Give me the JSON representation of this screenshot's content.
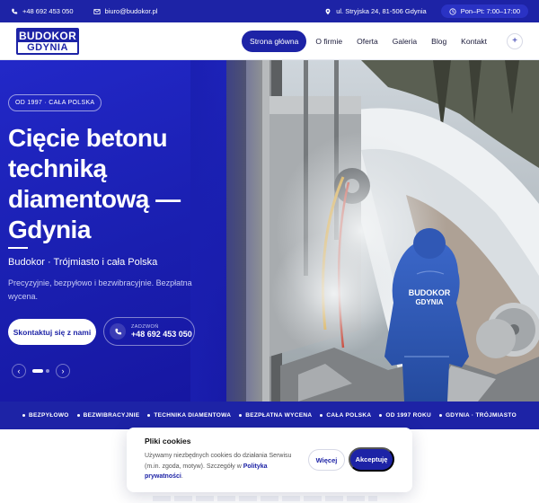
{
  "topbar": {
    "phone": "+48 692 453 050",
    "email": "biuro@budokor.pl",
    "address": "ul. Stryjska 24, 81-506 Gdynia",
    "hours": "Pon–Pt: 7:00–17:00"
  },
  "logo": {
    "top": "BUDOKOR",
    "bottom": "GDYNIA"
  },
  "nav": {
    "items": [
      "Strona główna",
      "O firmie",
      "Oferta",
      "Galeria",
      "Blog",
      "Kontakt"
    ],
    "plus": "+"
  },
  "hero": {
    "badge": "OD 1997 · CAŁA POLSKA",
    "title": "Cięcie betonu techniką diamentową — Gdynia",
    "subtitle": "Budokor · Trójmiasto i cała Polska",
    "description": "Precyzyjnie, bezpyłowo i bezwibracyjnie. Bezpłatna wycena.",
    "cta": "Skontaktuj się z nami",
    "call_label": "ZADZWOŃ",
    "call_number": "+48 692 453 050",
    "prev": "‹",
    "next": "›",
    "jacket_top": "BUDOKOR",
    "jacket_bottom": "GDYNIA"
  },
  "strip": [
    "BEZPYŁOWO",
    "BEZWIBRACYJNIE",
    "TECHNIKA DIAMENTOWA",
    "BEZPŁATNA WYCENA",
    "CAŁA POLSKA",
    "OD 1997 ROKU",
    "GDYNIA · TRÓJMIASTO"
  ],
  "cookie": {
    "title": "Pliki cookies",
    "body": "Używamy niezbędnych cookies do działania Serwisu (m.in. zgoda, motyw). Szczegóły w ",
    "link": "Polityka prywatności",
    "body_end": ".",
    "more": "Więcej",
    "accept": "Akceptuję"
  },
  "colors": {
    "brand": "#1d23a6",
    "accent": "#2228c8"
  }
}
